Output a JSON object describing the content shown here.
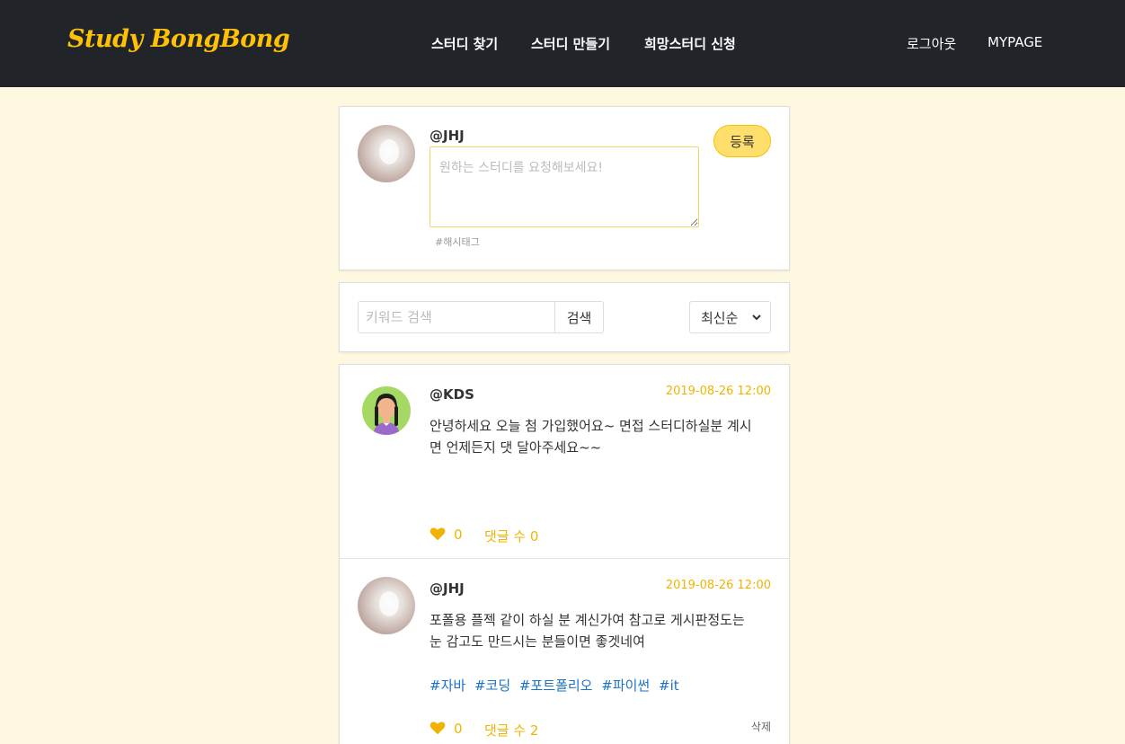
{
  "navbar": {
    "logo": "Study BongBong",
    "links": [
      "스터디 찾기",
      "스터디 만들기",
      "희망스터디 신청"
    ],
    "logout": "로그아웃",
    "mypage": "MYPAGE"
  },
  "compose": {
    "username": "@JHJ",
    "placeholder": "원하는 스터디를 요청해보세요!",
    "hashtag_hint": "#해시태그",
    "submit_label": "등록"
  },
  "search": {
    "placeholder": "키워드 검색",
    "button_label": "검색",
    "sort_selected": "최신순"
  },
  "posts": [
    {
      "username": "@KDS",
      "date": "2019-08-26 12:00",
      "text_line1": "안녕하세요 오늘 첨 가입했어요~ 면접 스터디하실분 계시",
      "text_line2": "면 언제든지 댓 달아주세요~~",
      "likes": "0",
      "comments": "댓글 수 0"
    },
    {
      "username": "@JHJ",
      "date": "2019-08-26 12:00",
      "text_line1": "포폴용 플젝 같이 하실 분 계신가여 참고로 게시판정도는",
      "text_line2": "눈 감고도 만드시는 분들이면 좋겟네여",
      "tags": [
        "#자바",
        "#코딩",
        "#포트폴리오",
        "#파이썬",
        "#it"
      ],
      "likes": "0",
      "comments": "댓글 수 2",
      "delete_label": "삭제"
    }
  ],
  "colors": {
    "navbar_bg": "#212529",
    "brand": "#ffc107",
    "page_bg": "#fff8e1",
    "accent": "#f0b400",
    "tag": "#1a73c8"
  }
}
